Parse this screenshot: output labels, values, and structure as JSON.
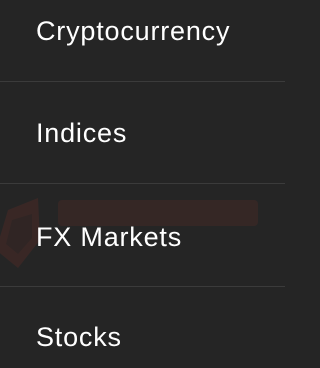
{
  "menu": {
    "items": [
      {
        "label": "Cryptocurrency"
      },
      {
        "label": "Indices"
      },
      {
        "label": "FX Markets"
      },
      {
        "label": "Stocks"
      }
    ]
  },
  "colors": {
    "background": "#252525",
    "text": "#ffffff",
    "divider": "#3b3b3b",
    "watermark": "#c0392b"
  },
  "watermark": {
    "icon": "brand-logo-watermark"
  }
}
